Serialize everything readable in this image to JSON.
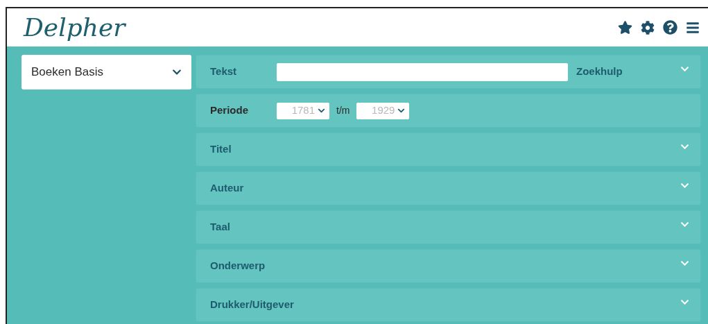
{
  "header": {
    "logo": "Delpher"
  },
  "collection_select": {
    "value": "Boeken Basis"
  },
  "rows": [
    {
      "kind": "text",
      "label": "Tekst",
      "expanded": false,
      "link": "Zoekhulp"
    },
    {
      "kind": "period",
      "label": "Periode",
      "expanded": true,
      "from": "1781",
      "separator": "t/m",
      "to": "1929"
    },
    {
      "kind": "facet",
      "label": "Titel",
      "expanded": false
    },
    {
      "kind": "facet",
      "label": "Auteur",
      "expanded": false
    },
    {
      "kind": "facet",
      "label": "Taal",
      "expanded": false
    },
    {
      "kind": "facet",
      "label": "Onderwerp",
      "expanded": false
    },
    {
      "kind": "facet",
      "label": "Drukker/Uitgever",
      "expanded": false
    }
  ]
}
